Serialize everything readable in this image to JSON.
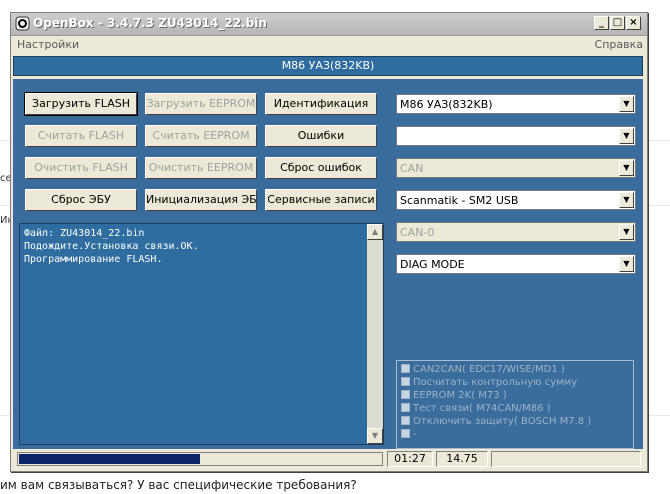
{
  "window": {
    "title": "OpenBox - 3.4.7.3 ZU43014_22.bin",
    "controls": {
      "minimize": "_",
      "maximize": "□",
      "close": "×"
    }
  },
  "menu": {
    "settings": "Настройки",
    "help": "Справка"
  },
  "header": {
    "title": "M86 УАЗ(832KB)"
  },
  "buttons": {
    "load_flash": "Загрузить FLASH",
    "load_eeprom": "Загрузить EEPROM",
    "identification": "Идентификация",
    "read_flash": "Считать FLASH",
    "read_eeprom": "Считать EEPROM",
    "errors": "Ошибки",
    "clear_flash": "Очистить FLASH",
    "clear_eeprom": "Очистить EEPROM",
    "reset_errors": "Сброс ошибок",
    "reset_ecu": "Сброс ЭБУ",
    "init_ecu": "Инициализация ЭБУ",
    "service_records": "Сервисные записи"
  },
  "log": {
    "lines": [
      "Файл: ZU43014_22.bin",
      "Подождите.Установка связи.OK.",
      "Программирование FLASH."
    ]
  },
  "combos": {
    "ecu": "M86 УАЗ(832KB)",
    "blank": "",
    "bus": "CAN",
    "adapter": "Scanmatik - SM2 USB",
    "channel": "CAN-0",
    "mode": "DIAG MODE"
  },
  "options": [
    "CAN2CAN( EDC17/WISE/MD1 )",
    "Посчитать контрольную сумму",
    "EEPROM 2K( M73 )",
    "Тест связи( M74CAN/M86 )",
    "Отключить защиту( BOSCH M7.8 )",
    "-"
  ],
  "status": {
    "progress_fraction": 0.5,
    "time": "01:27",
    "value": "14.75"
  },
  "background": {
    "frag1": "ce",
    "frag2": "Ин",
    "bottom_text": "им вам связываться? У вас специфические требования?"
  },
  "colors": {
    "panel": "#3a6c9c",
    "header": "#2f6c9f",
    "progress": "#0a246a"
  }
}
